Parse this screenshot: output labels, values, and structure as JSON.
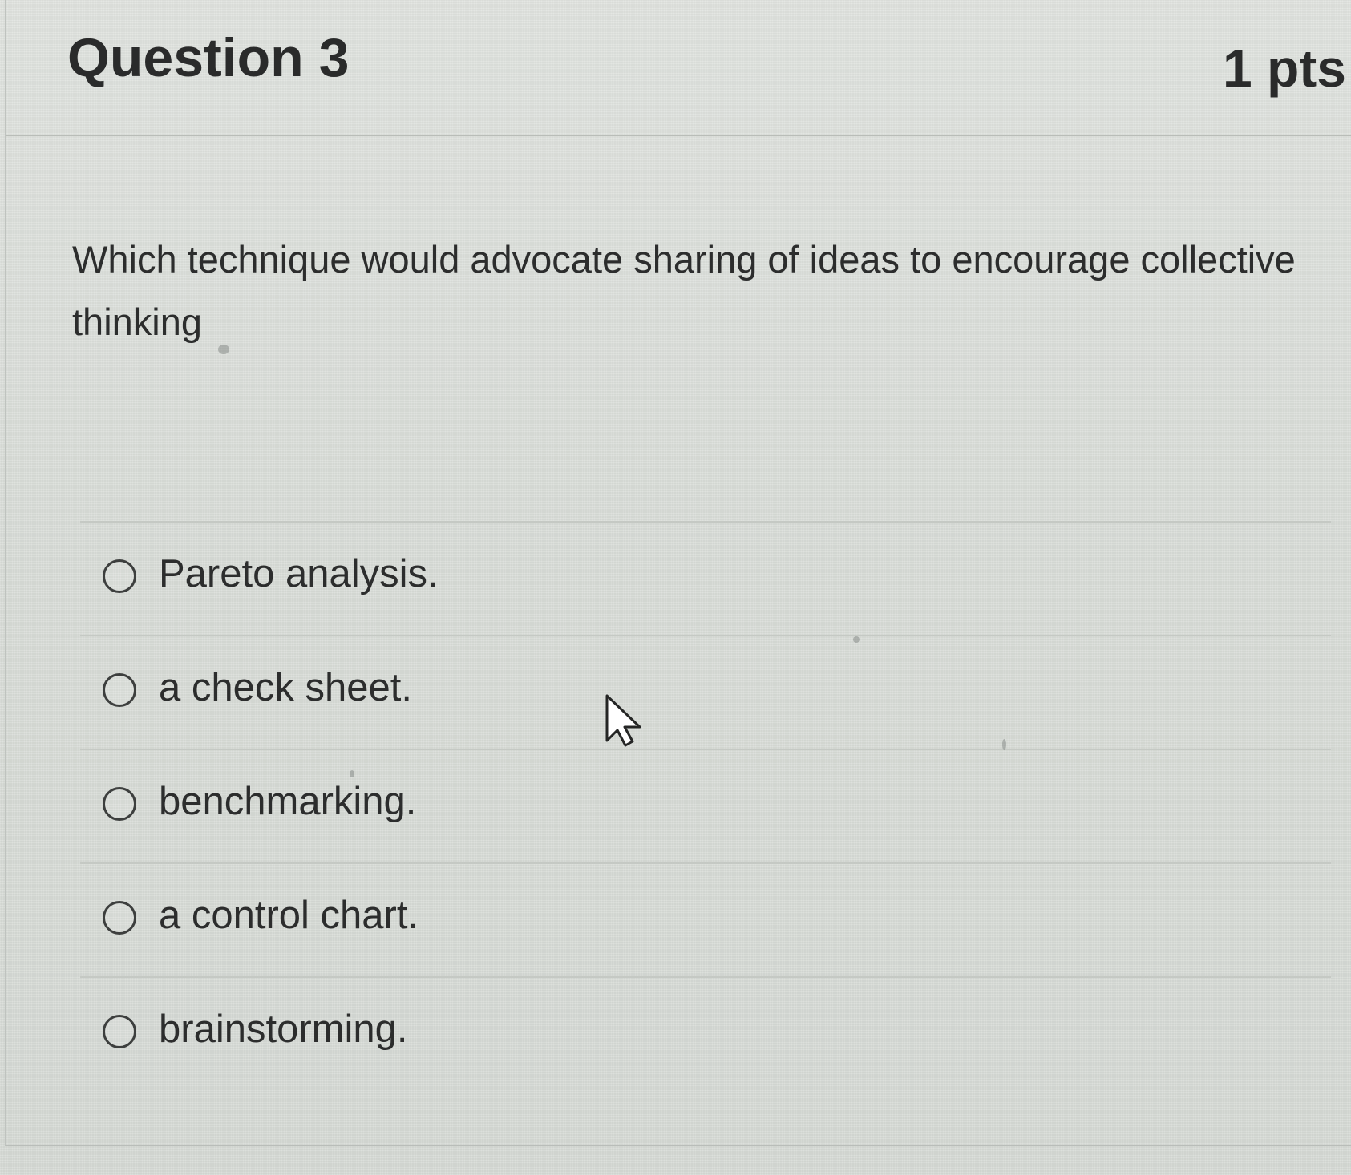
{
  "question": {
    "title": "Question 3",
    "points": "1 pts",
    "prompt": "Which technique would advocate sharing of ideas to encourage collective thinking"
  },
  "answers": [
    {
      "label": "Pareto analysis.",
      "selected": false
    },
    {
      "label": "a check sheet.",
      "selected": false
    },
    {
      "label": "benchmarking.",
      "selected": false
    },
    {
      "label": "a control chart.",
      "selected": false
    },
    {
      "label": "brainstorming.",
      "selected": false
    }
  ],
  "icons": {
    "radio": "radio-button-unselected",
    "cursor": "mouse-pointer"
  },
  "colors": {
    "background": "#d9ddd8",
    "text": "#2b2b2b",
    "divider": "#c5c9c4"
  }
}
